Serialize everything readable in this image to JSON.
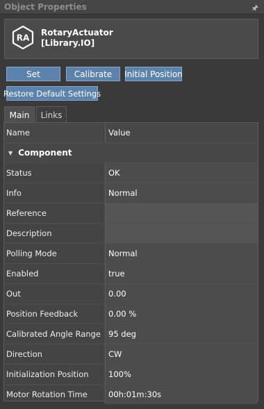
{
  "panel": {
    "title": "Object Properties",
    "pin_icon": "pin-icon"
  },
  "object": {
    "icon": "rotary-actuator-logo",
    "logo_text": "RA",
    "name_line1": "RotaryActuator",
    "name_line2": "[Library.IO]"
  },
  "buttons": {
    "set": "Set",
    "calibrate": "Calibrate",
    "initial_position": "Initial Position",
    "restore_defaults": "Restore Default Settings",
    "color": "#5d83ad"
  },
  "tabs": [
    {
      "label": "Main",
      "active": true
    },
    {
      "label": "Links",
      "active": false
    }
  ],
  "grid": {
    "columns": {
      "name": "Name",
      "value": "Value"
    },
    "category": "Component",
    "rows": [
      {
        "name": "Status",
        "value": "OK"
      },
      {
        "name": "Info",
        "value": "Normal"
      },
      {
        "name": "Reference",
        "value": ""
      },
      {
        "name": "Description",
        "value": ""
      },
      {
        "name": "Polling Mode",
        "value": "Normal"
      },
      {
        "name": "Enabled",
        "value": "true"
      },
      {
        "name": "Out",
        "value": "0.00"
      },
      {
        "name": "Position Feedback",
        "value": "0.00 %"
      },
      {
        "name": "Calibrated Angle Range",
        "value": "95 deg"
      },
      {
        "name": "Direction",
        "value": "CW"
      },
      {
        "name": "Initialization Position",
        "value": "100%"
      },
      {
        "name": "Motor Rotation Time",
        "value": "00h:01m:30s"
      }
    ]
  }
}
